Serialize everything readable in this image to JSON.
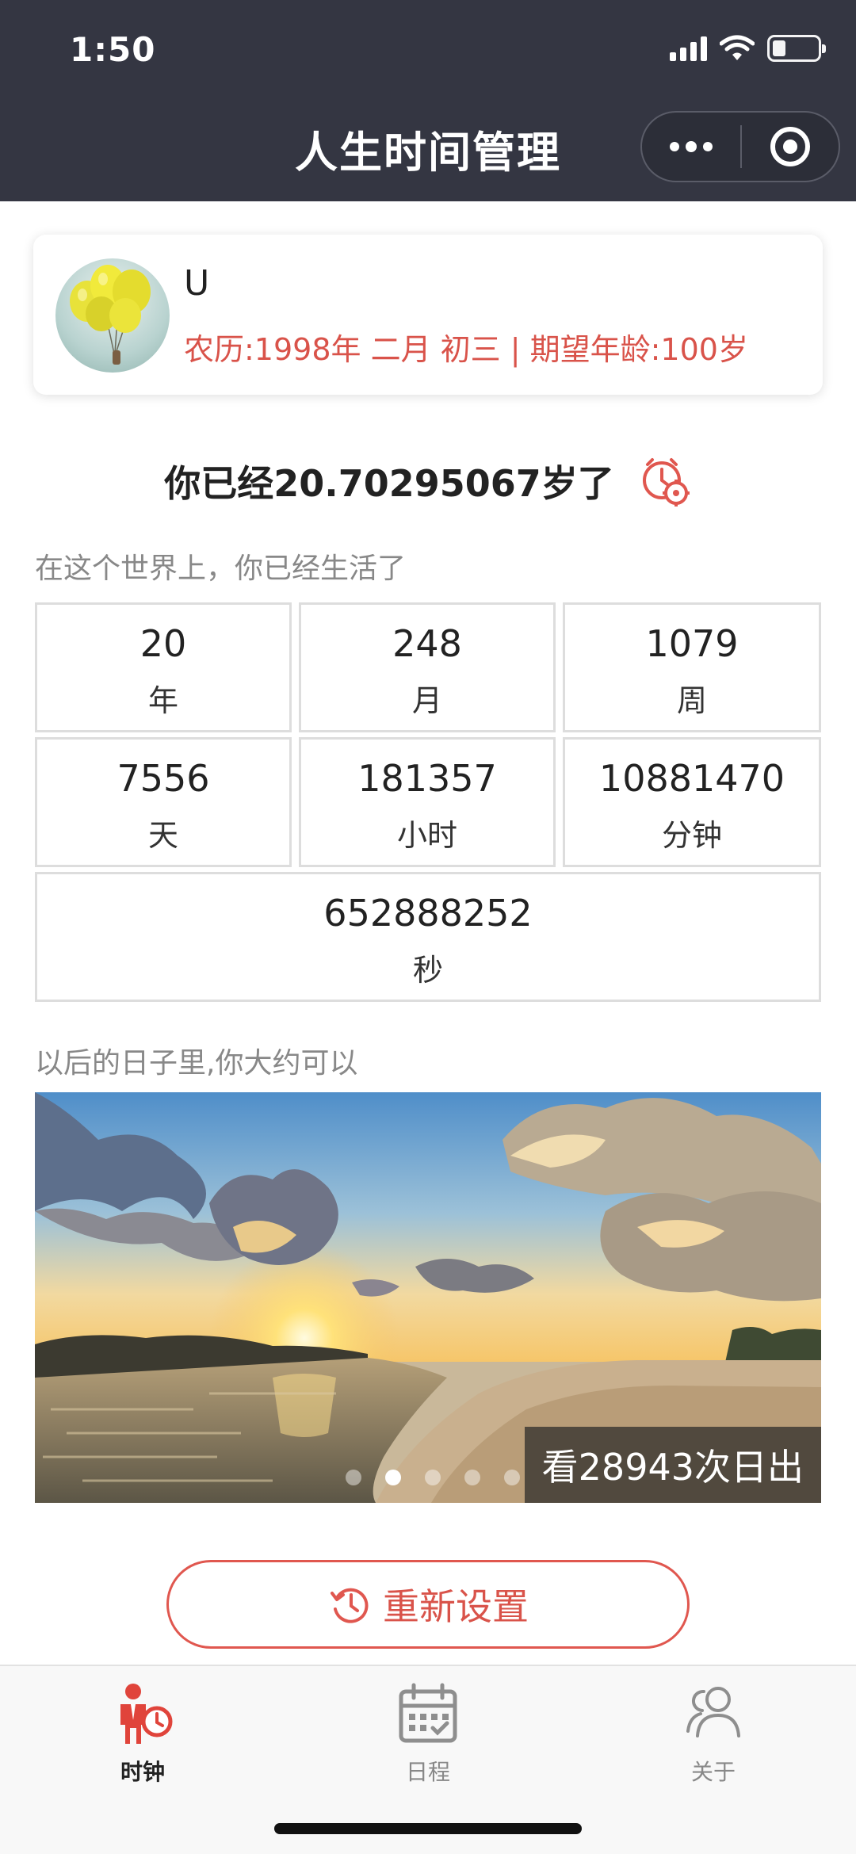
{
  "status_bar": {
    "time": "1:50"
  },
  "nav": {
    "title": "人生时间管理"
  },
  "profile": {
    "name": "U",
    "info": "农历:1998年 二月 初三 | 期望年龄:100岁"
  },
  "age": {
    "headline": "你已经20.70295067岁了"
  },
  "lived_label": "在这个世界上，你已经生活了",
  "stats": [
    {
      "value": "20",
      "unit": "年"
    },
    {
      "value": "248",
      "unit": "月"
    },
    {
      "value": "1079",
      "unit": "周"
    },
    {
      "value": "7556",
      "unit": "天"
    },
    {
      "value": "181357",
      "unit": "小时"
    },
    {
      "value": "10881470",
      "unit": "分钟"
    },
    {
      "value": "652888252",
      "unit": "秒"
    }
  ],
  "future_label": "以后的日子里,你大约可以",
  "banner": {
    "caption": "看28943次日出",
    "dots": 5,
    "active_dot": 2
  },
  "reset_button": {
    "label": "重新设置"
  },
  "tabs": [
    {
      "label": "时钟",
      "icon": "person-clock-icon",
      "active": true
    },
    {
      "label": "日程",
      "icon": "calendar-icon",
      "active": false
    },
    {
      "label": "关于",
      "icon": "users-icon",
      "active": false
    }
  ],
  "colors": {
    "accent": "#d9534a",
    "topbar": "#343642"
  }
}
